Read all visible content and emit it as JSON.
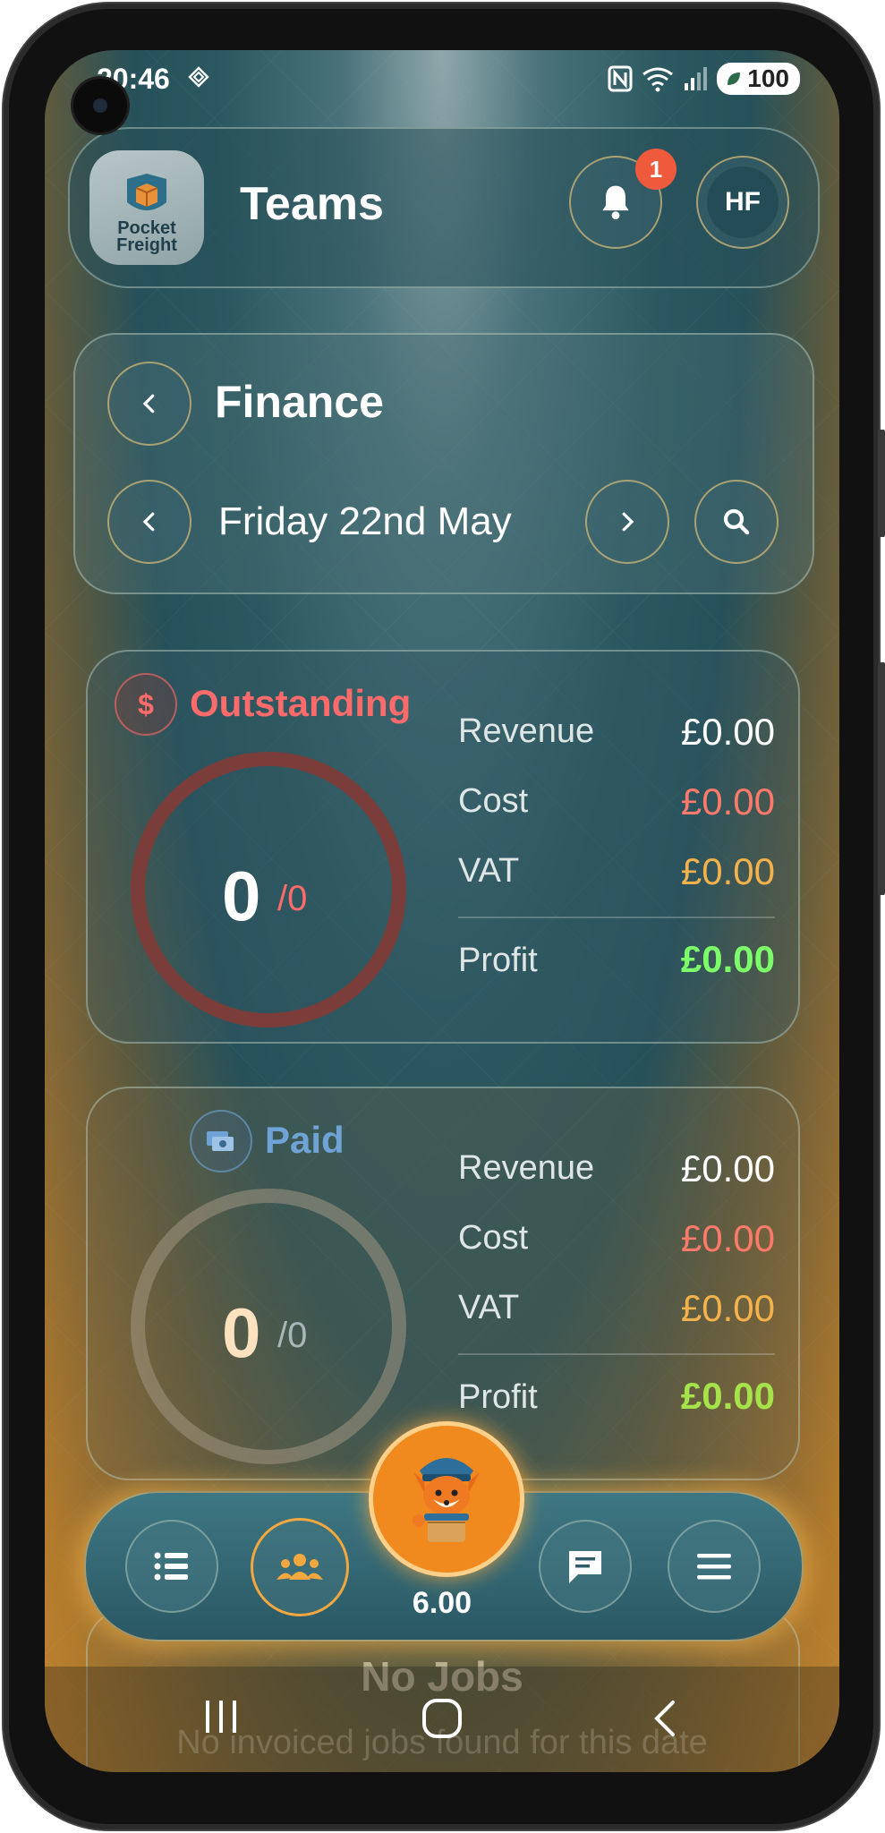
{
  "status_bar": {
    "time": "20:46",
    "battery": "100"
  },
  "header": {
    "logo_line1": "Pocket",
    "logo_line2": "Freight",
    "title": "Teams",
    "notification_count": "1",
    "avatar_initials": "HF"
  },
  "finance": {
    "title": "Finance",
    "date": "Friday 22nd May"
  },
  "outstanding": {
    "title": "Outstanding",
    "count": "0",
    "total": "/0",
    "rows": [
      {
        "label": "Revenue",
        "value": "£0.00"
      },
      {
        "label": "Cost",
        "value": "£0.00"
      },
      {
        "label": "VAT",
        "value": "£0.00"
      }
    ],
    "profit_label": "Profit",
    "profit_value": "£0.00"
  },
  "paid": {
    "title": "Paid",
    "count": "0",
    "total": "/0",
    "rows": [
      {
        "label": "Revenue",
        "value": "£0.00"
      },
      {
        "label": "Cost",
        "value": "£0.00"
      },
      {
        "label": "VAT",
        "value": "£0.00"
      }
    ],
    "profit_label": "Profit",
    "profit_value": "£0.00"
  },
  "empty_state": {
    "title": "No Jobs",
    "subtitle": "No invoiced jobs found for this date"
  },
  "bottom_nav": {
    "center_value": "6.00",
    "items": [
      "list-icon",
      "team-icon",
      "fox-mascot",
      "chat-icon",
      "menu-icon"
    ]
  },
  "colors": {
    "outstanding": "#ff6b6b",
    "paid": "#6fa3d6",
    "profit": "#7dff6a",
    "cost": "#ff7a6b",
    "vat": "#f4b24c",
    "accent": "#f2a83e"
  }
}
